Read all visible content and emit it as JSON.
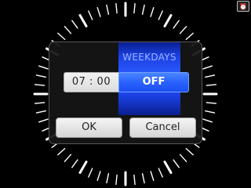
{
  "status": {
    "corner_icon": "alarm-status-icon",
    "corner_icon_text": "⏰"
  },
  "dialog": {
    "time_value": "07 : 00",
    "repeat_label": "WEEKDAYS",
    "alarm_state": "OFF",
    "ok_label": "OK",
    "cancel_label": "Cancel"
  },
  "colors": {
    "accent": "#2d5cff",
    "background": "#000000",
    "dial_ticks": "#ffffff"
  }
}
